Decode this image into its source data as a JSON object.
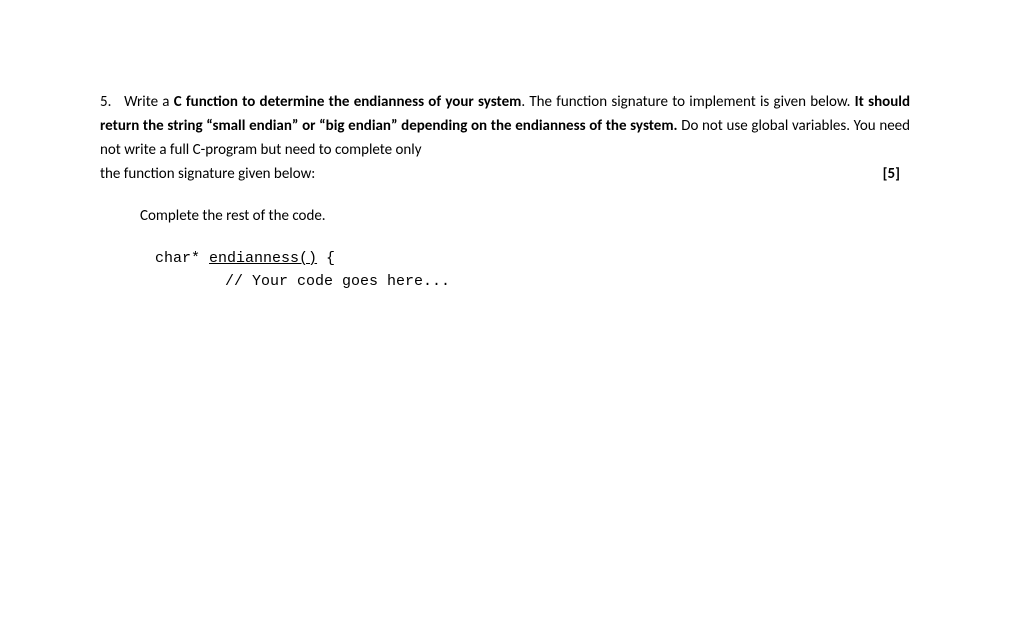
{
  "question": {
    "number": "5.",
    "part1": "Write a ",
    "bold1": "C function to determine the endianness of your system",
    "part2": ". The function signature to implement is given below. ",
    "bold2": "It should return the string “small endian” or “big endian” depending on the endianness of the system.",
    "part3": " Do not use global variables. You need not write a full C-program but need to complete only ",
    "part4_lastline": "the function signature given below:",
    "points": "[5]"
  },
  "instruction": "Complete the rest of the code.",
  "code": {
    "prefix": "char* ",
    "funcname": "endianness()",
    "brace": " {",
    "comment": "// Your code goes here..."
  }
}
